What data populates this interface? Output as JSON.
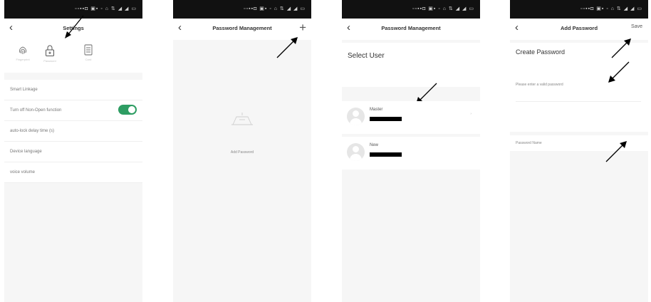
{
  "status_bar": {
    "text": "▫▫▪▪◘ ▣▪ ◦ ⌂ ⇅ ◢ ◢ ▭"
  },
  "screens": [
    {
      "title": "Settings",
      "features": [
        {
          "icon": "fingerprint-icon",
          "label": "Fingerprint"
        },
        {
          "icon": "lock-icon",
          "label": "Password"
        },
        {
          "icon": "card-icon",
          "label": "Card"
        }
      ],
      "settings": [
        {
          "label": "Smart Linkage",
          "value": ""
        },
        {
          "label": "Turn off Non-Open function",
          "value": "",
          "toggle": true
        },
        {
          "label": "auto-lock delay time (s)",
          "value": ""
        },
        {
          "label": "Device language",
          "value": ""
        },
        {
          "label": "voice volume",
          "value": ""
        }
      ]
    },
    {
      "title": "Password Management",
      "empty_text": "",
      "add_password_label": "Add Password"
    },
    {
      "title": "Password Management",
      "select_title": "Select User",
      "select_desc": "",
      "section_label": "",
      "users": [
        {
          "name": "Master"
        },
        {
          "name": "New"
        }
      ]
    },
    {
      "title": "Add Password",
      "save_label": "Save",
      "create_title": "Create Password",
      "create_desc": "",
      "password_prompt": "Please enter a valid password",
      "random_label": "",
      "hint": "",
      "name_label": "Password Name"
    }
  ],
  "colors": {
    "accent": "#2e9d63",
    "status_bar": "#111111"
  }
}
